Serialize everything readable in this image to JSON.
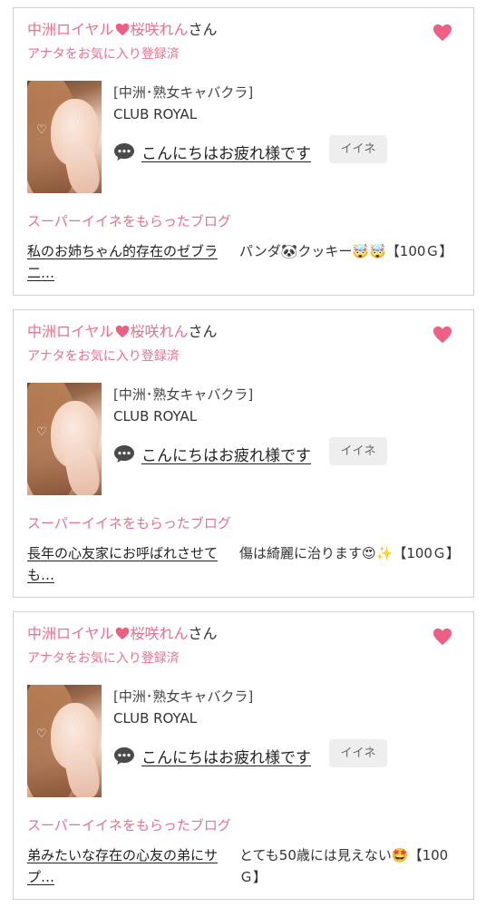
{
  "cards": [
    {
      "cast_prefix": "中洲ロイヤル",
      "cast_name": "桜咲れん",
      "honorific": "さん",
      "registered_note": "アナタをお気に入り登録済",
      "shop_category": "[中洲･熟女キャバクラ]",
      "shop_name": "CLUB ROYAL",
      "greeting": "こんにちはお疲れ様です",
      "iine_label": "イイネ",
      "blog_heading": "スーパーイイネをもらったブログ",
      "blog_title": "私のお姉ちゃん的存在のゼブラ二…",
      "blog_desc_text": "パンダ🐼クッキー🤯🤯【100Ｇ】"
    },
    {
      "cast_prefix": "中洲ロイヤル",
      "cast_name": "桜咲れん",
      "honorific": "さん",
      "registered_note": "アナタをお気に入り登録済",
      "shop_category": "[中洲･熟女キャバクラ]",
      "shop_name": "CLUB ROYAL",
      "greeting": "こんにちはお疲れ様です",
      "iine_label": "イイネ",
      "blog_heading": "スーパーイイネをもらったブログ",
      "blog_title": "長年の心友家にお呼ばれさせても…",
      "blog_desc_text": "傷は綺麗に治ります😍✨【100Ｇ】"
    },
    {
      "cast_prefix": "中洲ロイヤル",
      "cast_name": "桜咲れん",
      "honorific": "さん",
      "registered_note": "アナタをお気に入り登録済",
      "shop_category": "[中洲･熟女キャバクラ]",
      "shop_name": "CLUB ROYAL",
      "greeting": "こんにちはお疲れ様です",
      "iine_label": "イイネ",
      "blog_heading": "スーパーイイネをもらったブログ",
      "blog_title": "弟みたいな存在の心友の弟にサプ…",
      "blog_desc_text": "とても50歳には見えない🤩【100Ｇ】"
    }
  ],
  "colors": {
    "accent_pink": "#e8718d",
    "heart_pink": "#ef5f84",
    "border": "#cfcfcf",
    "button_bg": "#eeeeee"
  },
  "icons": {
    "favorite": "heart-icon",
    "name_separator": "heart-icon",
    "greeting": "speech-bubble-icon"
  }
}
